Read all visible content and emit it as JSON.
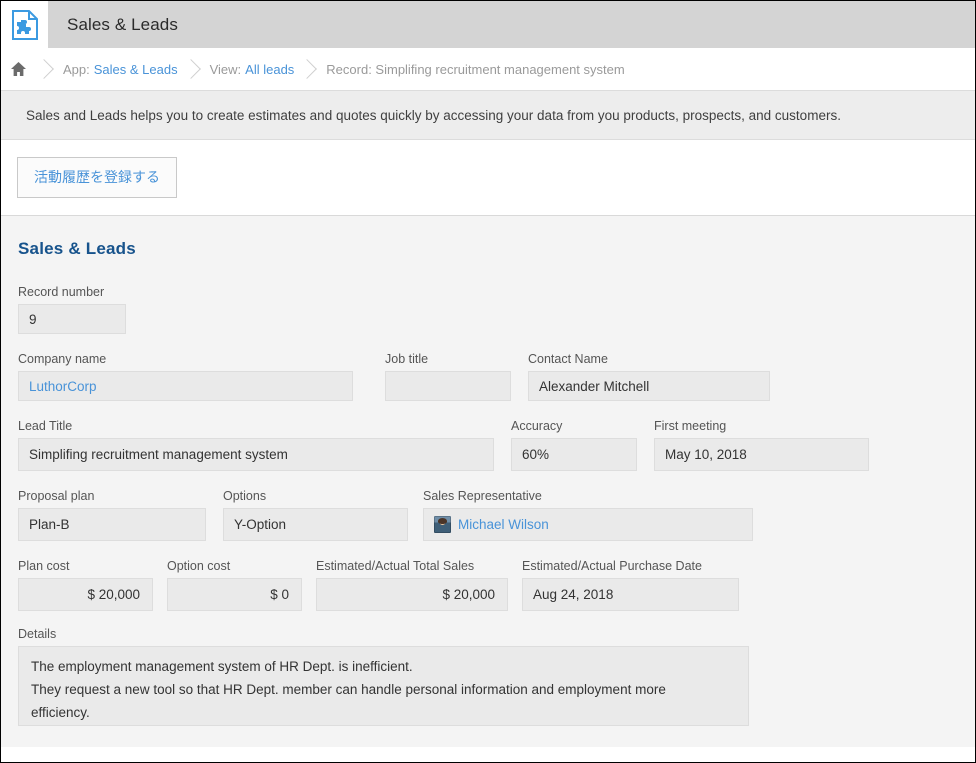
{
  "window": {
    "app_icon": "document-puzzle-icon",
    "title": "Sales & Leads"
  },
  "breadcrumb": {
    "home_icon": "home-icon",
    "items": [
      {
        "prefix": "App:",
        "link": "Sales & Leads"
      },
      {
        "prefix": "View:",
        "link": "All leads"
      },
      {
        "prefix": "Record: Simplifing recruitment management system",
        "link": ""
      }
    ]
  },
  "banner": {
    "text": "Sales and Leads helps you to create estimates and quotes quickly by accessing your data from you products, prospects, and customers."
  },
  "actions": {
    "register_label": "活動履歴を登録する"
  },
  "form": {
    "heading": "Sales & Leads",
    "record_number": {
      "label": "Record number",
      "value": "9"
    },
    "company_name": {
      "label": "Company name",
      "value": "LuthorCorp"
    },
    "job_title": {
      "label": "Job title",
      "value": ""
    },
    "contact_name": {
      "label": "Contact Name",
      "value": "Alexander Mitchell"
    },
    "lead_title": {
      "label": "Lead Title",
      "value": "Simplifing recruitment management system"
    },
    "accuracy": {
      "label": "Accuracy",
      "value": "60%"
    },
    "first_meeting": {
      "label": "First meeting",
      "value": "May 10, 2018"
    },
    "proposal_plan": {
      "label": "Proposal plan",
      "value": "Plan-B"
    },
    "options": {
      "label": "Options",
      "value": "Y-Option"
    },
    "sales_rep": {
      "label": "Sales Representative",
      "value": "Michael Wilson",
      "avatar": "user-photo-avatar"
    },
    "plan_cost": {
      "label": "Plan cost",
      "value": "$ 20,000"
    },
    "option_cost": {
      "label": "Option cost",
      "value": "$ 0"
    },
    "total_sales": {
      "label": "Estimated/Actual Total Sales",
      "value": "$ 20,000"
    },
    "purchase_date": {
      "label": "Estimated/Actual Purchase Date",
      "value": "Aug 24, 2018"
    },
    "details": {
      "label": "Details",
      "line1": "The employment management system of HR Dept. is inefficient.",
      "line2": "They request a new tool so that HR Dept. member can handle personal information and employment more",
      "line3": "efficiency."
    }
  },
  "colors": {
    "link": "#4993d8",
    "heading": "#17538c",
    "titlebar": "#d4d4d4",
    "banner": "#ededed",
    "field": "#eaeaea",
    "form_bg": "#f4f4f4"
  }
}
